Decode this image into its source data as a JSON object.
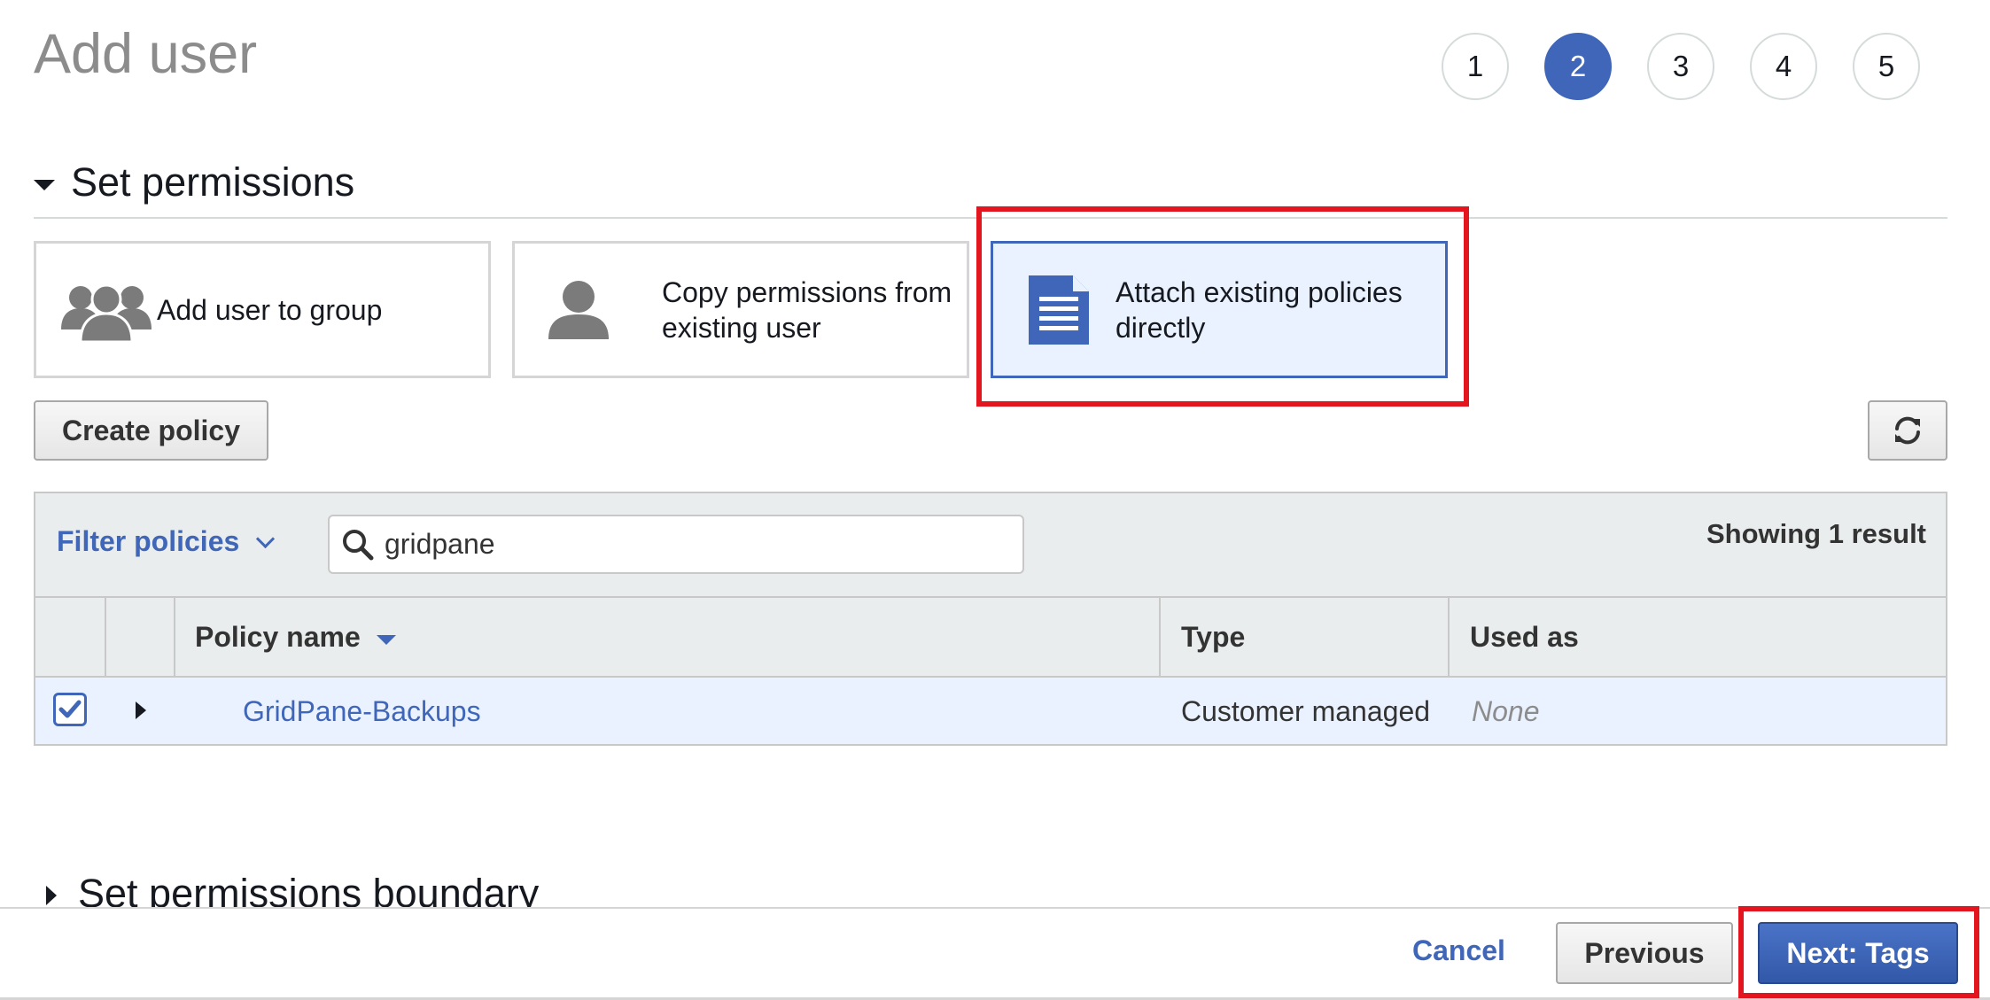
{
  "header": {
    "title": "Add user"
  },
  "steps": [
    {
      "label": "1",
      "active": false
    },
    {
      "label": "2",
      "active": true
    },
    {
      "label": "3",
      "active": false
    },
    {
      "label": "4",
      "active": false
    },
    {
      "label": "5",
      "active": false
    }
  ],
  "permissions": {
    "section_title": "Set permissions",
    "options": [
      {
        "label": "Add user to group",
        "icon": "user-group-icon",
        "selected": false
      },
      {
        "label": "Copy permissions from existing user",
        "icon": "user-icon",
        "selected": false
      },
      {
        "label": "Attach existing policies directly",
        "icon": "document-icon",
        "selected": true
      }
    ],
    "create_policy_label": "Create policy",
    "refresh_icon": "refresh-icon"
  },
  "filter": {
    "label": "Filter policies",
    "search_value": "gridpane",
    "search_icon": "search-icon",
    "result_text": "Showing 1 result"
  },
  "table": {
    "columns": [
      "Policy name",
      "Type",
      "Used as"
    ],
    "rows": [
      {
        "checked": true,
        "name": "GridPane-Backups",
        "type": "Customer managed",
        "used_as": "None"
      }
    ]
  },
  "boundary": {
    "section_title": "Set permissions boundary"
  },
  "footer": {
    "cancel_label": "Cancel",
    "previous_label": "Previous",
    "next_label": "Next: Tags"
  },
  "colors": {
    "accent": "#3f66b8",
    "highlight": "#e3161f",
    "selected_bg": "#eaf2ff",
    "table_header_bg": "#eaeded"
  }
}
